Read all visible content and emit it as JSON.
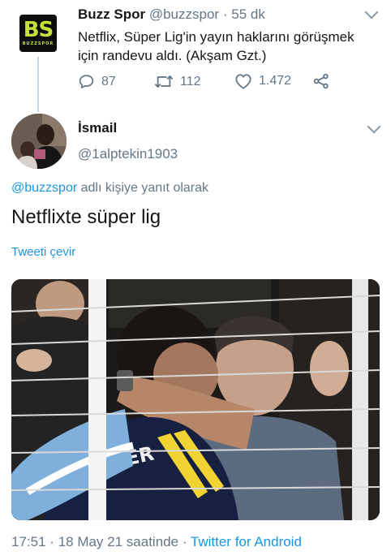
{
  "parent_tweet": {
    "logo_text": "BS",
    "logo_subtext": "BUZZSPOR",
    "name": "Buzz Spor",
    "handle": "@buzzspor",
    "separator": "·",
    "time": "55 dk",
    "text": "Netflix, Süper Lig'in yayın haklarını görüşmek için randevu aldı. (Akşam Gzt.)",
    "replies": "87",
    "retweets": "112",
    "likes": "1.472",
    "colors": {
      "logo_bg": "#0d0d0d",
      "logo_fg": "#c6e03a"
    }
  },
  "reply_tweet": {
    "name": "İsmail",
    "handle": "@1alptekin1903",
    "reply_to_mention": "@buzzspor",
    "reply_to_suffix": " adlı kişiye yanıt olarak",
    "text": "Netflixte süper lig",
    "translate_label": "Tweeti çevir",
    "time": "17:51",
    "date_text": "18 May 21 saatinde",
    "source": "Twitter for Android",
    "photo_jersey_text": "ELER"
  },
  "colors": {
    "link": "#1b95e0",
    "secondary_text": "#657786",
    "primary_text": "#14171a"
  }
}
